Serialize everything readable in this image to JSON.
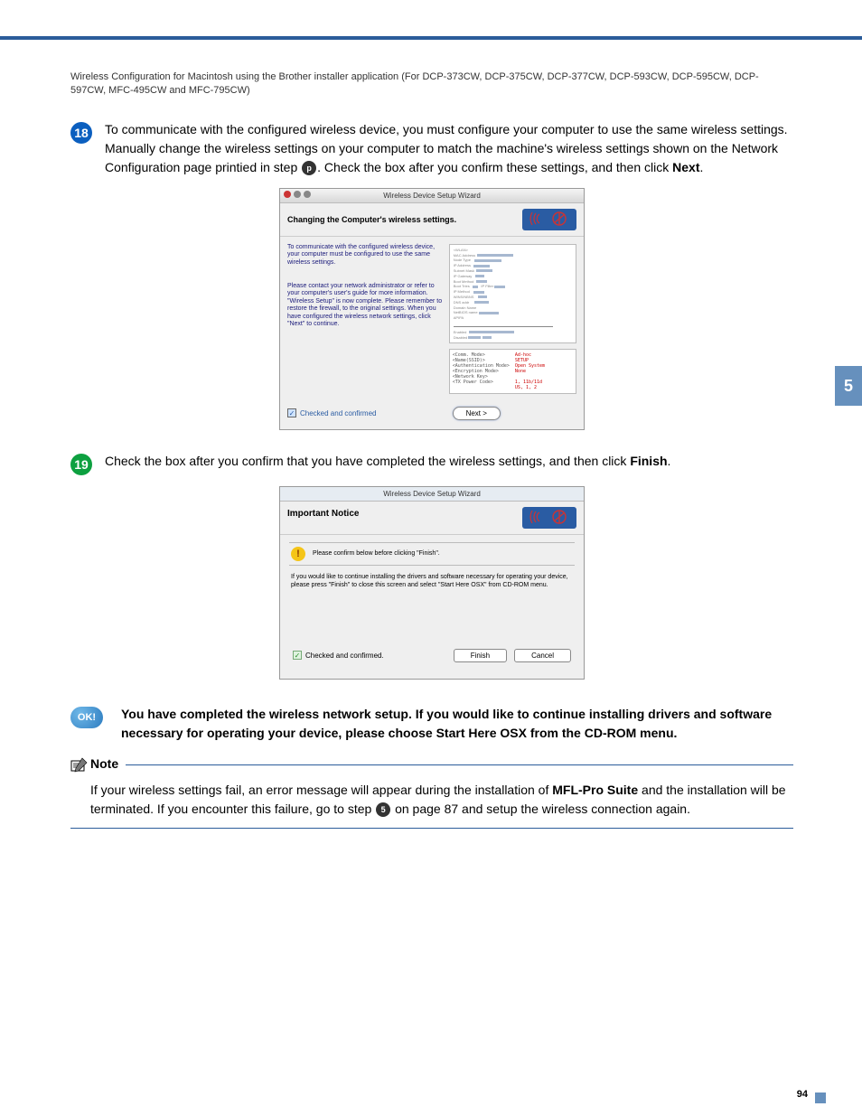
{
  "chapter": "5",
  "page_number": "94",
  "header": "Wireless Configuration for Macintosh using the Brother installer application (For DCP-373CW, DCP-375CW, DCP-377CW, DCP-593CW, DCP-595CW, DCP-597CW, MFC-495CW and MFC-795CW)",
  "step18": {
    "num": "18",
    "text_a": "To communicate with the configured wireless device, you must configure your computer to use the same wireless settings. Manually change the wireless settings on your computer to match the machine's wireless settings shown on the Network Configuration page printied in step ",
    "ref": "p",
    "text_b": ". Check the box after you confirm these settings, and then click ",
    "bold": "Next",
    "text_c": "."
  },
  "dlg1": {
    "title": "Wireless Device Setup Wizard",
    "heading": "Changing the Computer's wireless settings.",
    "p1": "To communicate with the configured wireless device, your computer must be configured to use the same wireless settings.",
    "p2": "Please contact your network administrator or refer to your computer's user's guide for more information.\n\"Wireless Setup\" is now complete. Please remember to restore the firewall, to the original settings. When you have configured the wireless network settings, click \"Next\" to continue.",
    "chk": "Checked and confirmed",
    "btn": "Next >",
    "details": "<Comm. Mode>\n<Name(SSID)>\n<Authentication Mode>\n<Encryption Mode>\n<Network Key>\n<TX Power Code>",
    "details_r": "Ad-hoc\nSETUP\nOpen System\nNone\n\n1, 11b/11d\nUS, 1, 2"
  },
  "step19": {
    "num": "19",
    "text_a": "Check the box after you confirm that you have completed the wireless settings, and then click ",
    "bold": "Finish",
    "text_b": "."
  },
  "dlg2": {
    "title": "Wireless Device Setup Wizard",
    "heading": "Important Notice",
    "confirm": "Please confirm below before clicking \"Finish\".",
    "msg": "If you would like to continue installing the drivers and software necessary for operating your device, please press \"Finish\" to close this screen and select \"Start Here OSX\" from CD-ROM menu.",
    "chk": "Checked and confirmed.",
    "finish": "Finish",
    "cancel": "Cancel"
  },
  "ok": {
    "badge": "OK!",
    "text": "You have completed the wireless network setup. If you would like to continue installing drivers and software necessary for operating your device, please choose Start Here OSX from the CD-ROM menu."
  },
  "note": {
    "label": "Note",
    "t1": "If your wireless settings fail, an error message will appear during the installation of ",
    "b1": "MFL-Pro Suite",
    "t2": " and the installation will be terminated. If you encounter this failure,  go to step ",
    "ref": "5",
    "t3": " on page 87 and setup the wireless connection again."
  }
}
